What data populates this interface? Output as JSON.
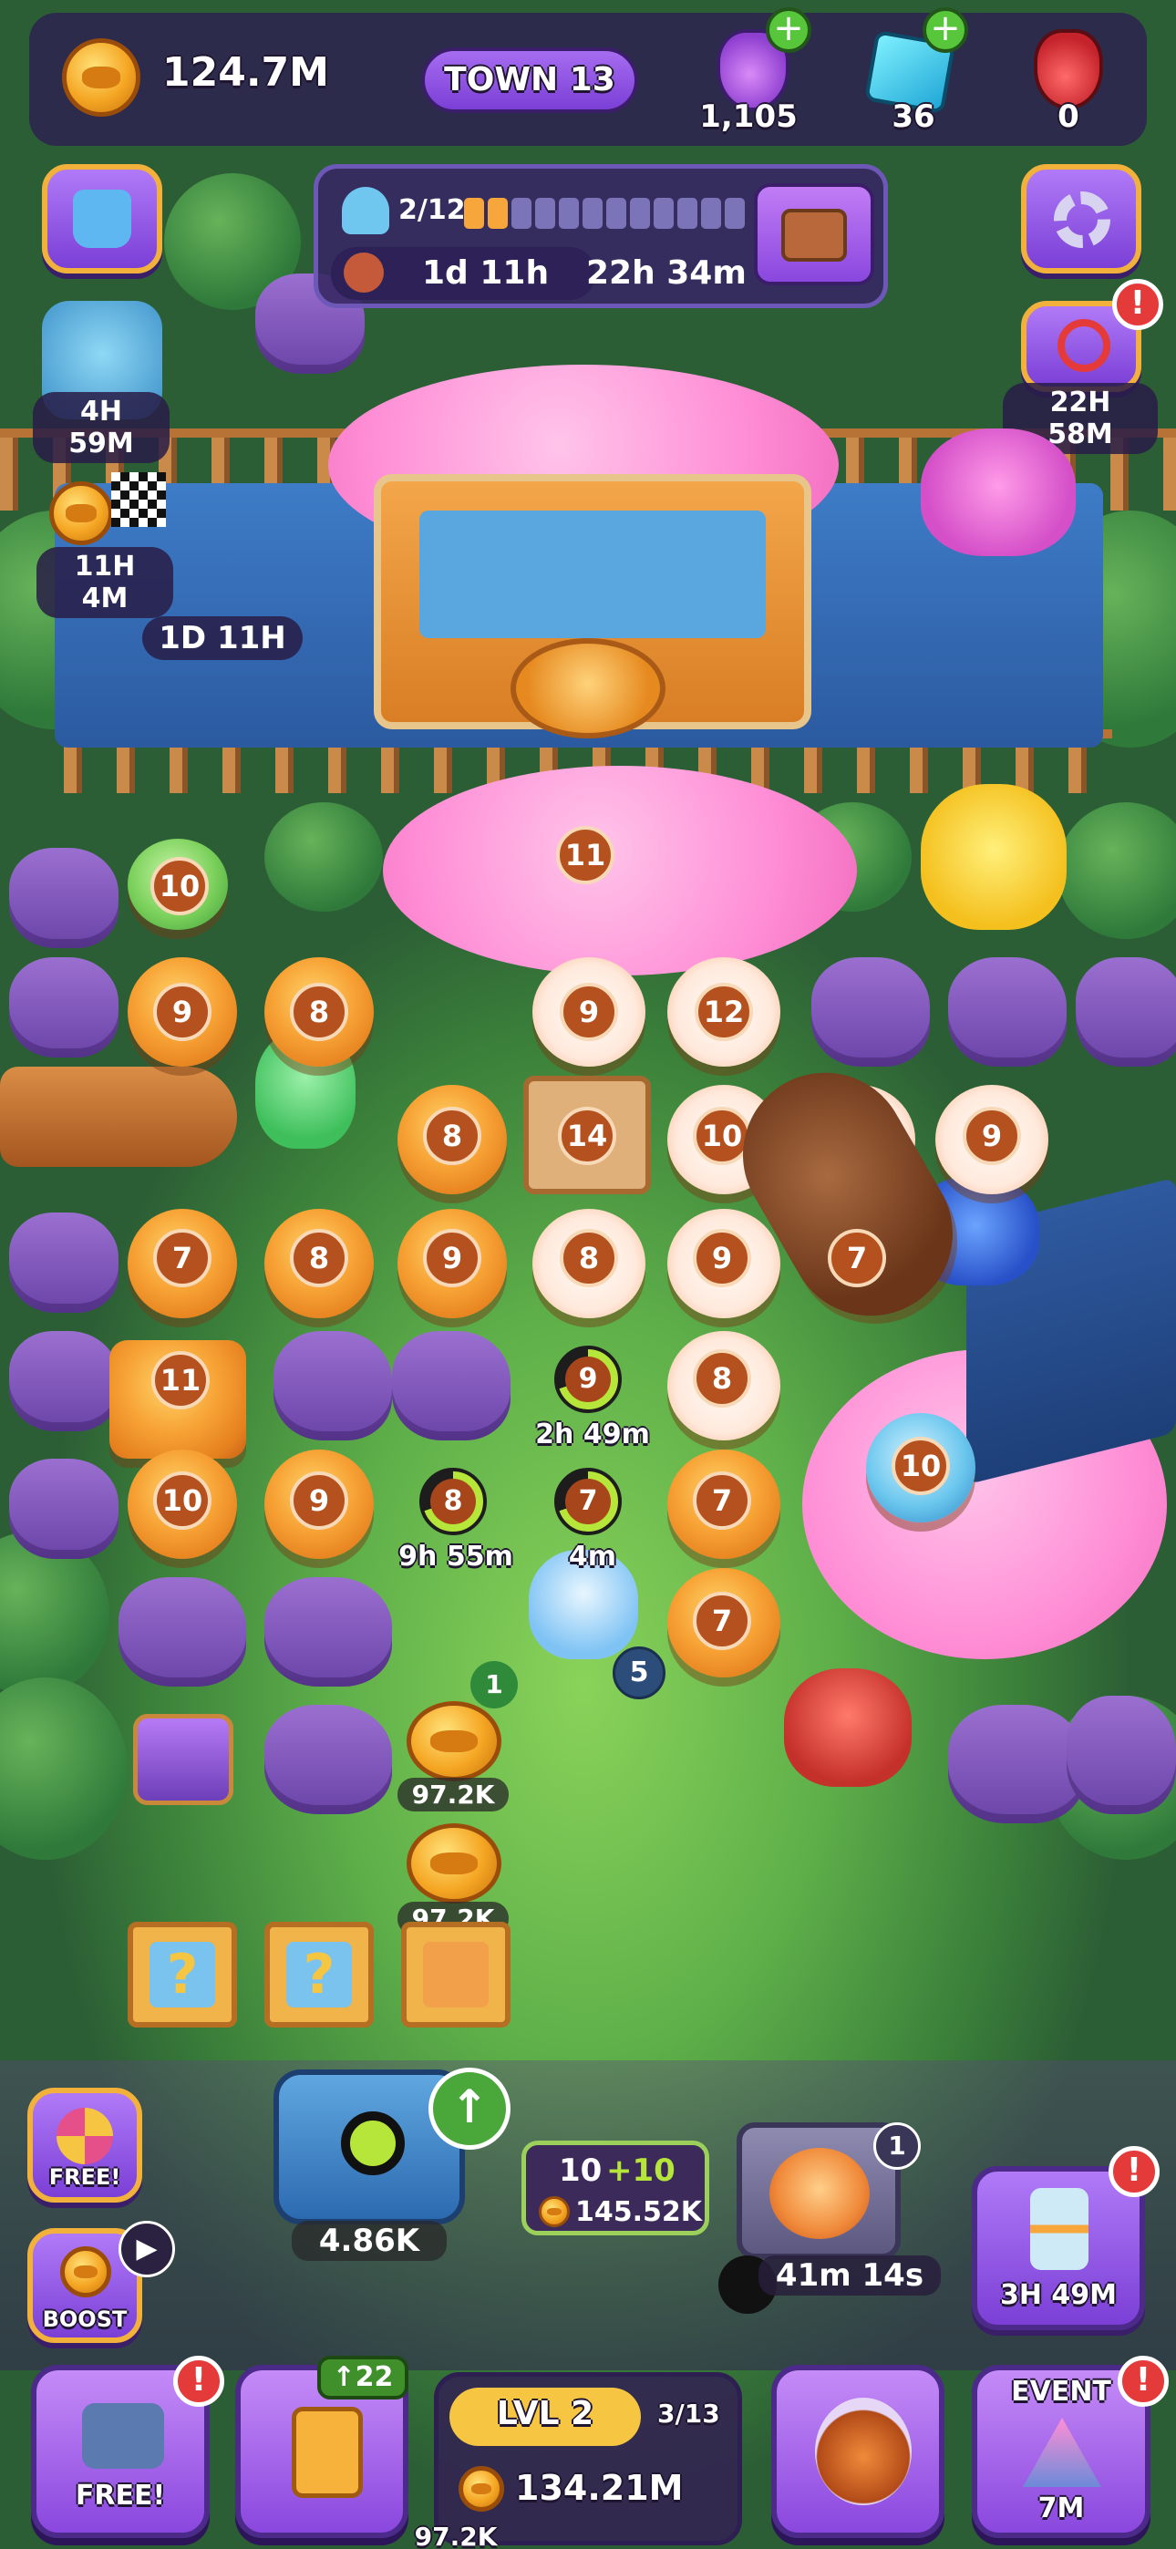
{
  "top_bar": {
    "coins": "124.7M",
    "town": "TOWN 13",
    "potions_purple": "1,105",
    "gems": "36",
    "potions_red": "0",
    "icons": [
      "coin-icon",
      "purple-potion-icon",
      "gem-icon",
      "red-potion-icon",
      "plus-icon"
    ]
  },
  "event_panel": {
    "progress": "2/12",
    "progress_value": 0.17,
    "timer_left": "1d 11h",
    "timer_right": "22h 34m"
  },
  "side_timers": {
    "left_monster": "4H 59M",
    "left_race": "11H 4M",
    "board_1d": "1D 11H",
    "right_blocked": "22H 58M"
  },
  "board": {
    "tokens": [
      {
        "id": "t1",
        "level": "10"
      },
      {
        "id": "t2",
        "level": "11"
      },
      {
        "id": "t3",
        "level": "9"
      },
      {
        "id": "t4",
        "level": "8"
      },
      {
        "id": "t5",
        "level": "9"
      },
      {
        "id": "t6",
        "level": "12"
      },
      {
        "id": "t7",
        "level": "8"
      },
      {
        "id": "t8",
        "level": "14"
      },
      {
        "id": "t9",
        "level": "10"
      },
      {
        "id": "t10",
        "level": "8"
      },
      {
        "id": "t11",
        "level": "9"
      },
      {
        "id": "t12",
        "level": "7"
      },
      {
        "id": "t13",
        "level": "8"
      },
      {
        "id": "t14",
        "level": "9"
      },
      {
        "id": "t15",
        "level": "8"
      },
      {
        "id": "t16",
        "level": "9"
      },
      {
        "id": "t17",
        "level": "7"
      },
      {
        "id": "t18",
        "level": "11"
      },
      {
        "id": "t19",
        "level": "9"
      },
      {
        "id": "t20",
        "level": "8"
      },
      {
        "id": "t21",
        "level": "10"
      },
      {
        "id": "t22",
        "level": "9"
      },
      {
        "id": "t23",
        "level": "8"
      },
      {
        "id": "t24",
        "level": "7"
      },
      {
        "id": "t25",
        "level": "7"
      },
      {
        "id": "t26",
        "level": "10"
      },
      {
        "id": "t27",
        "level": "7"
      }
    ],
    "cook_timers": {
      "t19": "2h 49m",
      "t23": "9h 55m",
      "t24": "4m"
    },
    "pet_badge": "5",
    "stack_count": "1",
    "coin_values": [
      "97.2K",
      "97.2K"
    ],
    "bottom_value": "97.2K"
  },
  "machines": {
    "cannon_value": "4.86K",
    "merge_counter": {
      "top": "10",
      "bonus": "+10",
      "cost": "145.52K"
    },
    "oven_count": "1",
    "oven_timer": "41m 14s"
  },
  "left_buttons": {
    "wheel": "FREE!",
    "boost": "BOOST"
  },
  "right_buttons": {
    "hourglass": "3H 49M",
    "event": "EVENT",
    "event_timer": "7M"
  },
  "dock": {
    "shop": "FREE!",
    "cards_badge": "↑22",
    "level": "LVL 2",
    "level_progress": "3/13",
    "level_coins": "134.21M",
    "alert": "!"
  }
}
